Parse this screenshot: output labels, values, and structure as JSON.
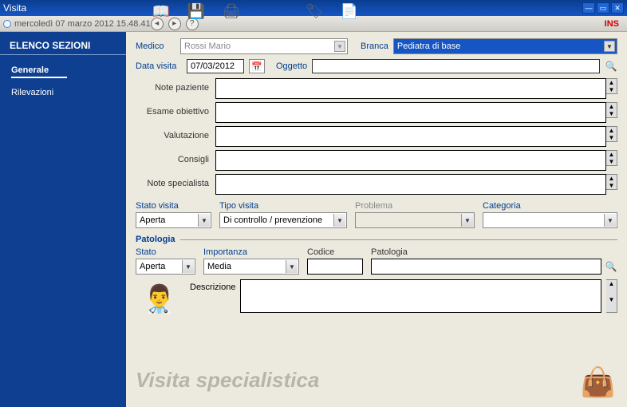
{
  "window": {
    "title": "Visita"
  },
  "statusbar": {
    "datetime": "mercoledì 07 marzo 2012    15.48.41",
    "ins": "INS"
  },
  "sidebar": {
    "header": "ELENCO SEZIONI",
    "items": [
      {
        "label": "Generale",
        "active": true
      },
      {
        "label": "Rilevazioni",
        "active": false
      }
    ]
  },
  "form": {
    "medico_label": "Medico",
    "medico_value": "Rossi Mario",
    "branca_label": "Branca",
    "branca_value": "Pediatra di base",
    "data_visita_label": "Data visita",
    "data_visita_value": "07/03/2012",
    "oggetto_label": "Oggetto",
    "oggetto_value": "",
    "notes": [
      {
        "label": "Note paziente",
        "value": ""
      },
      {
        "label": "Esame obiettivo",
        "value": ""
      },
      {
        "label": "Valutazione",
        "value": ""
      },
      {
        "label": "Consigli",
        "value": ""
      },
      {
        "label": "Note specialista",
        "value": ""
      }
    ],
    "stato_visita_label": "Stato visita",
    "stato_visita_value": "Aperta",
    "tipo_visita_label": "Tipo visita",
    "tipo_visita_value": "Di controllo / prevenzione",
    "problema_label": "Problema",
    "problema_value": "",
    "categoria_label": "Categoria",
    "categoria_value": ""
  },
  "patologia": {
    "legend": "Patologia",
    "stato_label": "Stato",
    "stato_value": "Aperta",
    "importanza_label": "Importanza",
    "importanza_value": "Media",
    "codice_label": "Codice",
    "codice_value": "",
    "patologia_label": "Patologia",
    "patologia_value": "",
    "descrizione_label": "Descrizione",
    "descrizione_value": ""
  },
  "footer": {
    "watermark": "Visita specialistica"
  }
}
